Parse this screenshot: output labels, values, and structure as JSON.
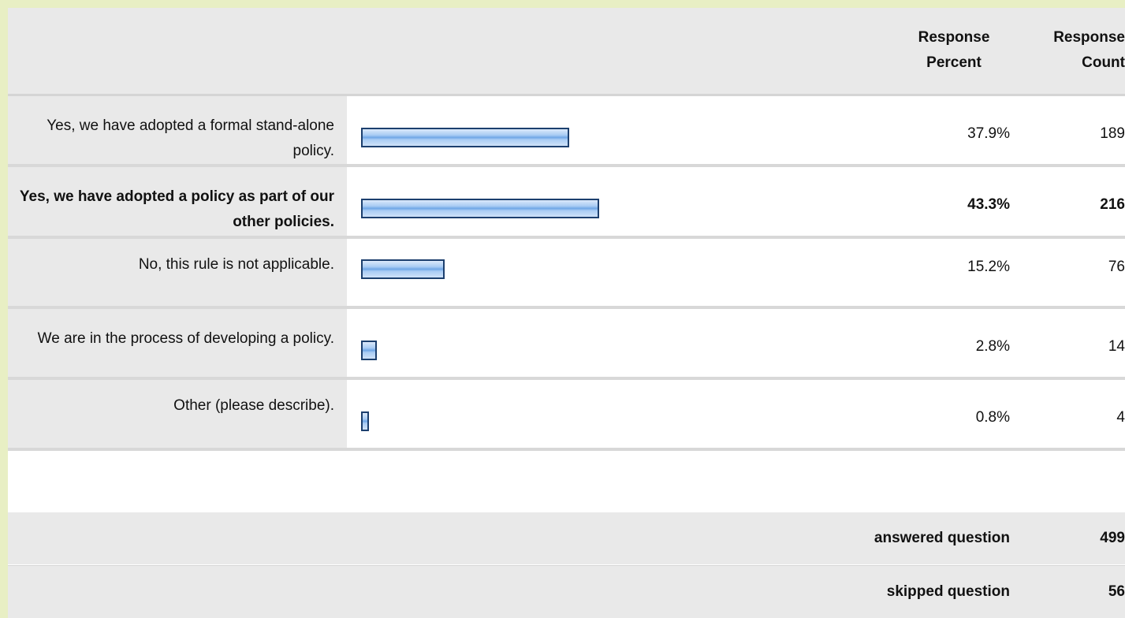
{
  "header": {
    "percent_label_1": "Response",
    "percent_label_2": "Percent",
    "count_label_1": "Response",
    "count_label_2": "Count"
  },
  "chart_data": {
    "type": "bar",
    "orientation": "horizontal",
    "categories": [
      "Yes, we have adopted a formal stand-alone policy.",
      "Yes, we have adopted a policy as part of our other policies.",
      "No, this rule is not applicable.",
      "We are in the process of developing a policy.",
      "Other (please describe)."
    ],
    "percent_display": [
      "37.9%",
      "43.3%",
      "15.2%",
      "2.8%",
      "0.8%"
    ],
    "values": [
      37.9,
      43.3,
      15.2,
      2.8,
      0.8
    ],
    "counts": [
      "189",
      "216",
      "76",
      "14",
      "4"
    ],
    "highlighted_index": 1,
    "bar_color": "#6fa6e6",
    "bar_border_color": "#1c3f6e"
  },
  "summary": {
    "answered_label": "answered question",
    "answered_value": "499",
    "skipped_label": "skipped question",
    "skipped_value": "56"
  }
}
